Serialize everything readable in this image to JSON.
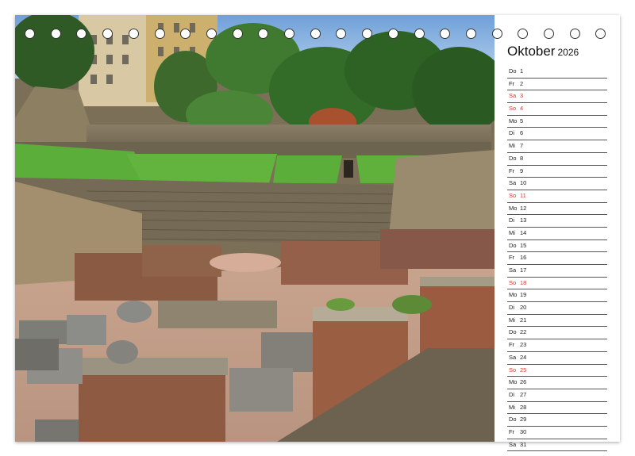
{
  "calendar": {
    "month": "Oktober",
    "year": "2026",
    "days": [
      {
        "weekday": "Do",
        "day": "1",
        "sunday": false
      },
      {
        "weekday": "Fr",
        "day": "2",
        "sunday": false
      },
      {
        "weekday": "Sa",
        "day": "3",
        "sunday": true
      },
      {
        "weekday": "So",
        "day": "4",
        "sunday": true
      },
      {
        "weekday": "Mo",
        "day": "5",
        "sunday": false
      },
      {
        "weekday": "Di",
        "day": "6",
        "sunday": false
      },
      {
        "weekday": "Mi",
        "day": "7",
        "sunday": false
      },
      {
        "weekday": "Do",
        "day": "8",
        "sunday": false
      },
      {
        "weekday": "Fr",
        "day": "9",
        "sunday": false
      },
      {
        "weekday": "Sa",
        "day": "10",
        "sunday": false
      },
      {
        "weekday": "So",
        "day": "11",
        "sunday": true
      },
      {
        "weekday": "Mo",
        "day": "12",
        "sunday": false
      },
      {
        "weekday": "Di",
        "day": "13",
        "sunday": false
      },
      {
        "weekday": "Mi",
        "day": "14",
        "sunday": false
      },
      {
        "weekday": "Do",
        "day": "15",
        "sunday": false
      },
      {
        "weekday": "Fr",
        "day": "16",
        "sunday": false
      },
      {
        "weekday": "Sa",
        "day": "17",
        "sunday": false
      },
      {
        "weekday": "So",
        "day": "18",
        "sunday": true
      },
      {
        "weekday": "Mo",
        "day": "19",
        "sunday": false
      },
      {
        "weekday": "Di",
        "day": "20",
        "sunday": false
      },
      {
        "weekday": "Mi",
        "day": "21",
        "sunday": false
      },
      {
        "weekday": "Do",
        "day": "22",
        "sunday": false
      },
      {
        "weekday": "Fr",
        "day": "23",
        "sunday": false
      },
      {
        "weekday": "Sa",
        "day": "24",
        "sunday": false
      },
      {
        "weekday": "So",
        "day": "25",
        "sunday": true
      },
      {
        "weekday": "Mo",
        "day": "26",
        "sunday": false
      },
      {
        "weekday": "Di",
        "day": "27",
        "sunday": false
      },
      {
        "weekday": "Mi",
        "day": "28",
        "sunday": false
      },
      {
        "weekday": "Do",
        "day": "29",
        "sunday": false
      },
      {
        "weekday": "Fr",
        "day": "30",
        "sunday": false
      },
      {
        "weekday": "Sa",
        "day": "31",
        "sunday": false
      }
    ]
  },
  "colors": {
    "holiday_red": "#c8402a",
    "text": "#222222",
    "rule_line": "#555555"
  },
  "binding_ring_count": 23
}
